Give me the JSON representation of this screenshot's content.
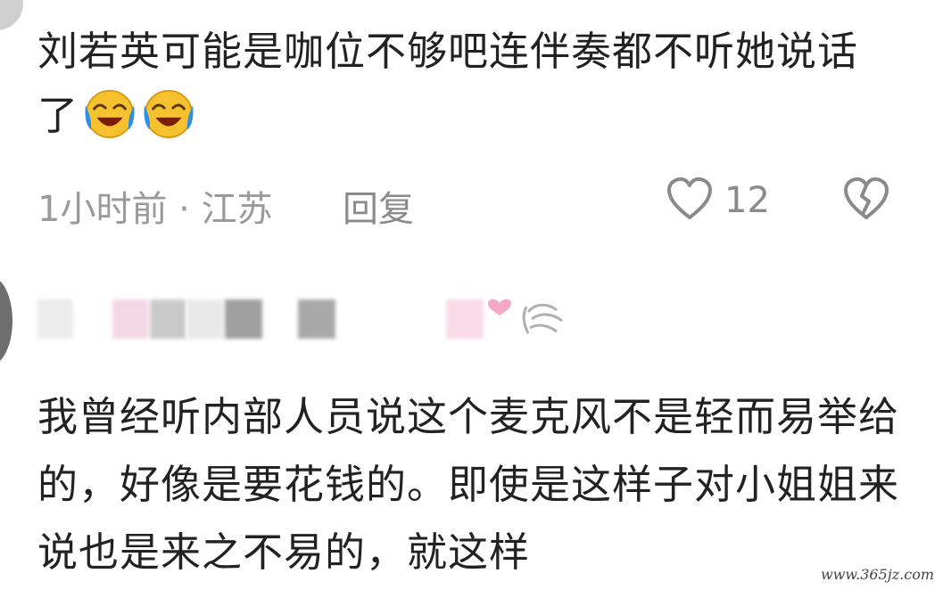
{
  "comment_1": {
    "text": "刘若英可能是咖位不够吧连伴奏都不听她说话了",
    "emoji": [
      "laugh-cry-emoji",
      "laugh-cry-emoji"
    ],
    "time_location": "1小时前 · 江苏",
    "reply_label": "回复",
    "like_count": "12"
  },
  "comment_2": {
    "text": "我曾经听内部人员说这个麦克风不是轻而易举给的，好像是要花钱的。即使是这样子对小姐姐来说也是来之不易的，就这样"
  },
  "watermark": "www.365jz.com",
  "colors": {
    "text": "#222222",
    "meta": "#9a9a9a",
    "emoji_face": "#f6c12e",
    "emoji_tear": "#2f8fe8"
  }
}
